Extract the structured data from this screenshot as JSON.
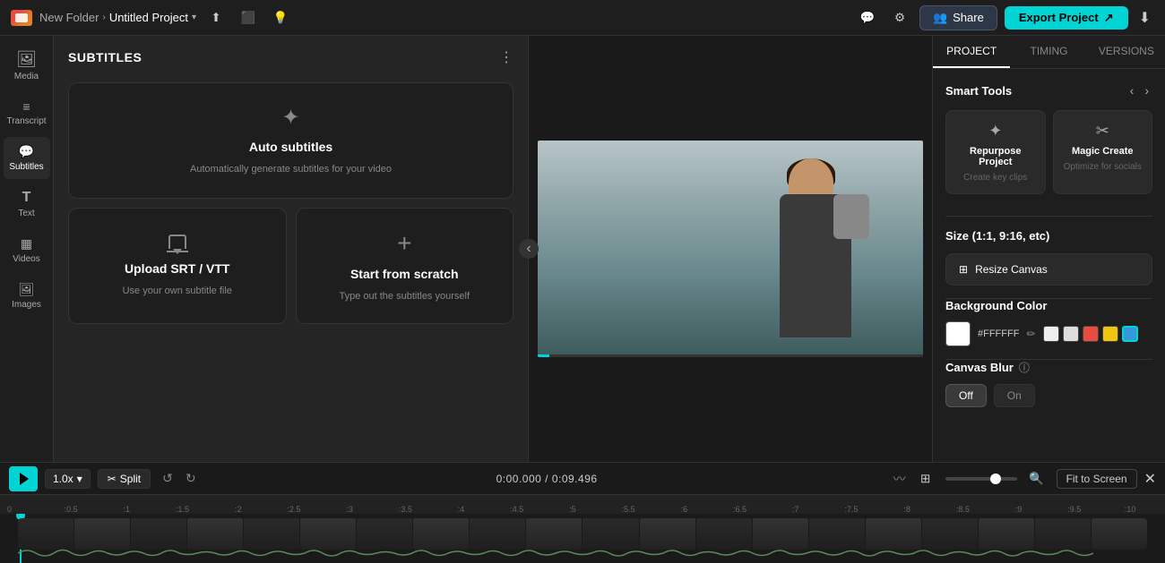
{
  "topbar": {
    "logo_label": "Logo",
    "folder_name": "New Folder",
    "separator": "›",
    "project_name": "Untitled Project",
    "dropdown_icon": "▾",
    "upload_icon": "⬆",
    "monitor_icon": "🖥",
    "bulb_icon": "💡",
    "chat_icon": "💬",
    "settings_icon": "⚙",
    "share_label": "Share",
    "export_label": "Export Project",
    "download_icon": "⬇"
  },
  "sidebar": {
    "items": [
      {
        "id": "media",
        "label": "Media",
        "icon": "🖼"
      },
      {
        "id": "transcript",
        "label": "Transcript",
        "icon": "📝"
      },
      {
        "id": "subtitles",
        "label": "Subtitles",
        "icon": "💬",
        "active": true
      },
      {
        "id": "text",
        "label": "Text",
        "icon": "T"
      },
      {
        "id": "videos",
        "label": "Videos",
        "icon": "🎬"
      },
      {
        "id": "images",
        "label": "Images",
        "icon": "🖼"
      }
    ]
  },
  "subtitle_panel": {
    "title": "SUBTITLES",
    "cards": {
      "auto": {
        "title": "Auto subtitles",
        "description": "Automatically generate subtitles for your video",
        "icon": "sparkle"
      },
      "upload": {
        "title": "Upload SRT / VTT",
        "description": "Use your own subtitle file",
        "icon": "upload"
      },
      "scratch": {
        "title": "Start from scratch",
        "description": "Type out the subtitles yourself",
        "icon": "plus"
      }
    }
  },
  "right_panel": {
    "tabs": [
      {
        "id": "project",
        "label": "PROJECT",
        "active": true
      },
      {
        "id": "timing",
        "label": "TIMING",
        "active": false
      },
      {
        "id": "versions",
        "label": "VERSIONS",
        "active": false
      }
    ],
    "smart_tools": {
      "title": "Smart Tools",
      "tools": [
        {
          "id": "repurpose",
          "title": "Repurpose Project",
          "desc": "Create key clips",
          "icon": "✦"
        },
        {
          "id": "magic_create",
          "title": "Magic Create",
          "desc": "Optimize for socials",
          "icon": "✂"
        }
      ]
    },
    "size_section": {
      "title": "Size (1:1, 9:16, etc)",
      "button_label": "Resize Canvas",
      "button_icon": "⊞"
    },
    "background_color": {
      "title": "Background Color",
      "hex_value": "#FFFFFF",
      "swatches": [
        {
          "color": "#FFFFFF",
          "active": false
        },
        {
          "color": "#EEEEEE",
          "active": false
        },
        {
          "color": "#E74C3C",
          "active": false
        },
        {
          "color": "#F1C40F",
          "active": false
        },
        {
          "color": "#3498DB",
          "active": true
        }
      ]
    },
    "canvas_blur": {
      "title": "Canvas Blur",
      "off_label": "Off",
      "on_label": "On"
    }
  },
  "bottom_controls": {
    "play_label": "Play",
    "speed": "1.0x",
    "split_label": "Split",
    "split_icon": "✂",
    "undo_icon": "↺",
    "redo_icon": "↻",
    "timecode": "0:00.000",
    "timecode_total": "/ 0:09.496",
    "fit_screen_label": "Fit to Screen",
    "close_label": "✕"
  },
  "timeline": {
    "ruler_marks": [
      "0",
      ":0.5",
      ":1",
      ":1.5",
      ":2",
      ":2.5",
      ":3",
      ":3.5",
      ":4",
      ":4.5",
      ":5",
      ":5.5",
      ":6",
      ":6.5",
      ":7",
      ":7.5",
      ":8",
      ":8.5",
      ":9",
      ":9.5",
      ":10"
    ]
  }
}
